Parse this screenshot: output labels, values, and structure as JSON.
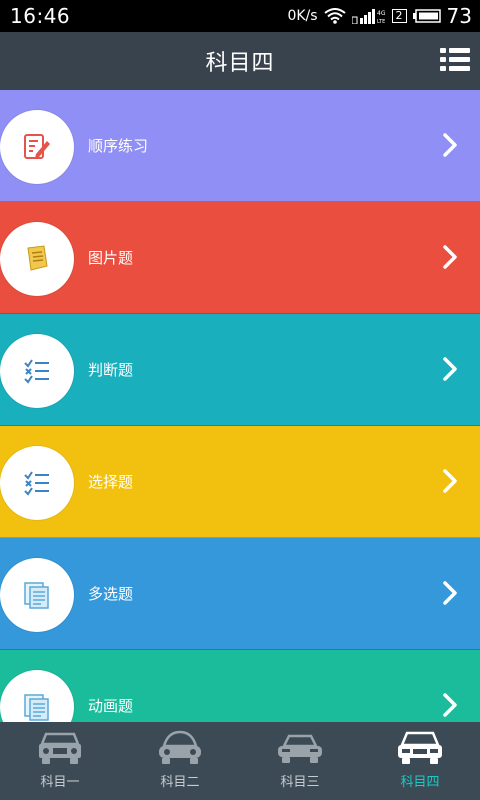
{
  "status": {
    "time": "16:46",
    "speed": "0K/s",
    "sim": "2",
    "battery": "73"
  },
  "header": {
    "title": "科目四"
  },
  "list": [
    {
      "label": "顺序练习",
      "color": "#8f8ff5",
      "icon": "edit-document-icon"
    },
    {
      "label": "图片题",
      "color": "#e94e3e",
      "icon": "paper-scroll-icon"
    },
    {
      "label": "判断题",
      "color": "#1aafbd",
      "icon": "checklist-icon"
    },
    {
      "label": "选择题",
      "color": "#f2c110",
      "icon": "checklist-icon"
    },
    {
      "label": "多选题",
      "color": "#3498db",
      "icon": "multi-document-icon"
    },
    {
      "label": "动画题",
      "color": "#1bbc9b",
      "icon": "multi-document-icon"
    }
  ],
  "nav": [
    {
      "label": "科目一",
      "icon": "jeep-icon",
      "active": false
    },
    {
      "label": "科目二",
      "icon": "beetle-car-icon",
      "active": false
    },
    {
      "label": "科目三",
      "icon": "sedan-car-icon",
      "active": false
    },
    {
      "label": "科目四",
      "icon": "suv-car-icon",
      "active": true
    }
  ],
  "colors": {
    "header": "#39434e",
    "nav": "#3b4a55",
    "accent": "#1ec9c3"
  }
}
